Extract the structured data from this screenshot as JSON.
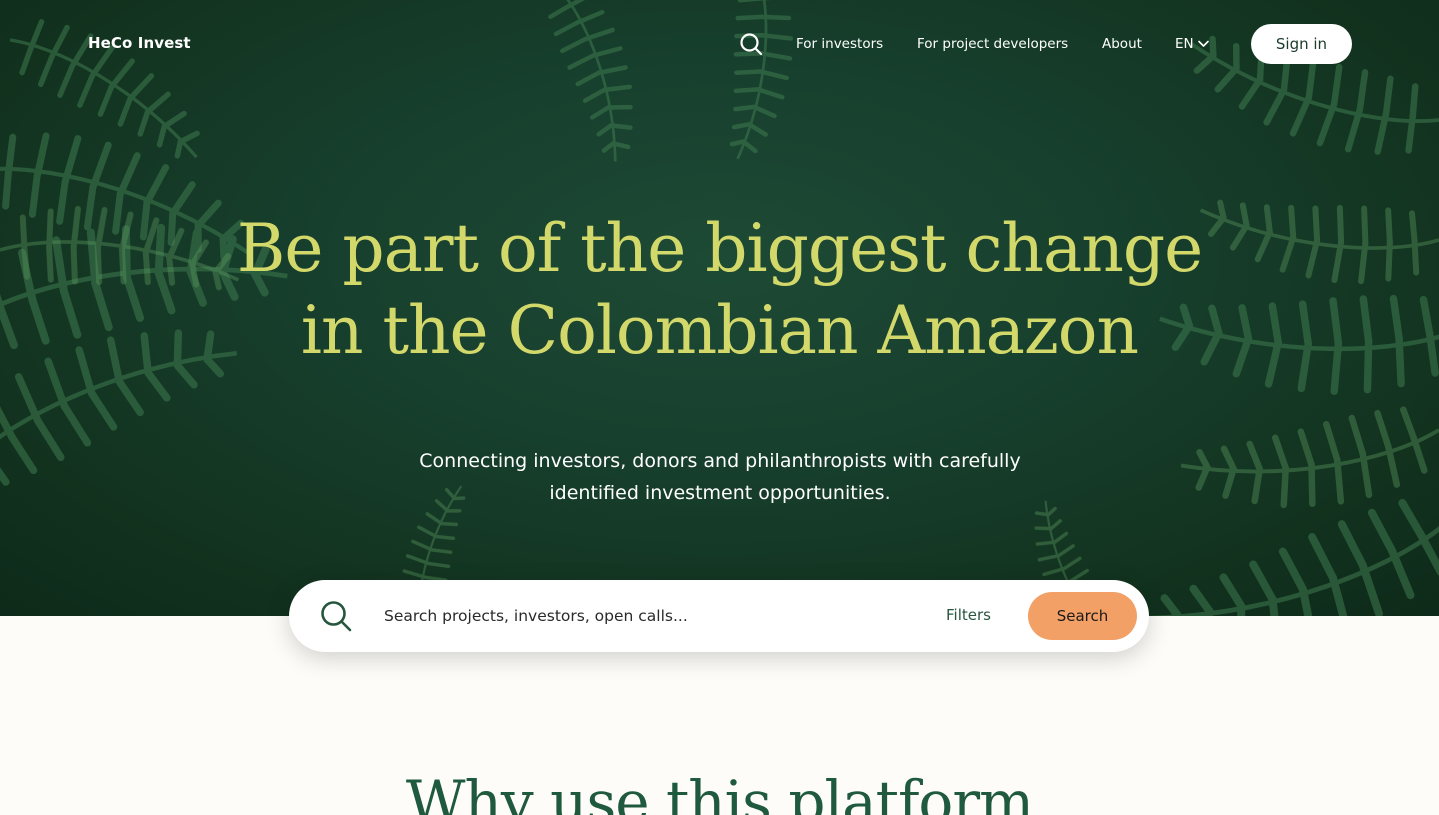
{
  "nav": {
    "brand": "HeCo Invest",
    "links": [
      "For investors",
      "For project developers",
      "About"
    ],
    "language": "EN",
    "sign_in": "Sign in"
  },
  "hero": {
    "headline_line1": "Be part of the biggest change",
    "headline_line2": "in the Colombian Amazon",
    "subline_line1": "Connecting investors, donors and philanthropists with carefully",
    "subline_line2": "identified investment opportunities."
  },
  "search": {
    "placeholder": "Search projects, investors, open calls...",
    "filters_label": "Filters",
    "button_label": "Search"
  },
  "section": {
    "title": "Why use this platform"
  },
  "colors": {
    "headline": "#d3d86a",
    "search_button": "#f2a065",
    "hero_background": "#173f2d",
    "section_title": "#1f5a3e"
  },
  "icons": [
    "search-icon",
    "chevron-down-icon"
  ]
}
